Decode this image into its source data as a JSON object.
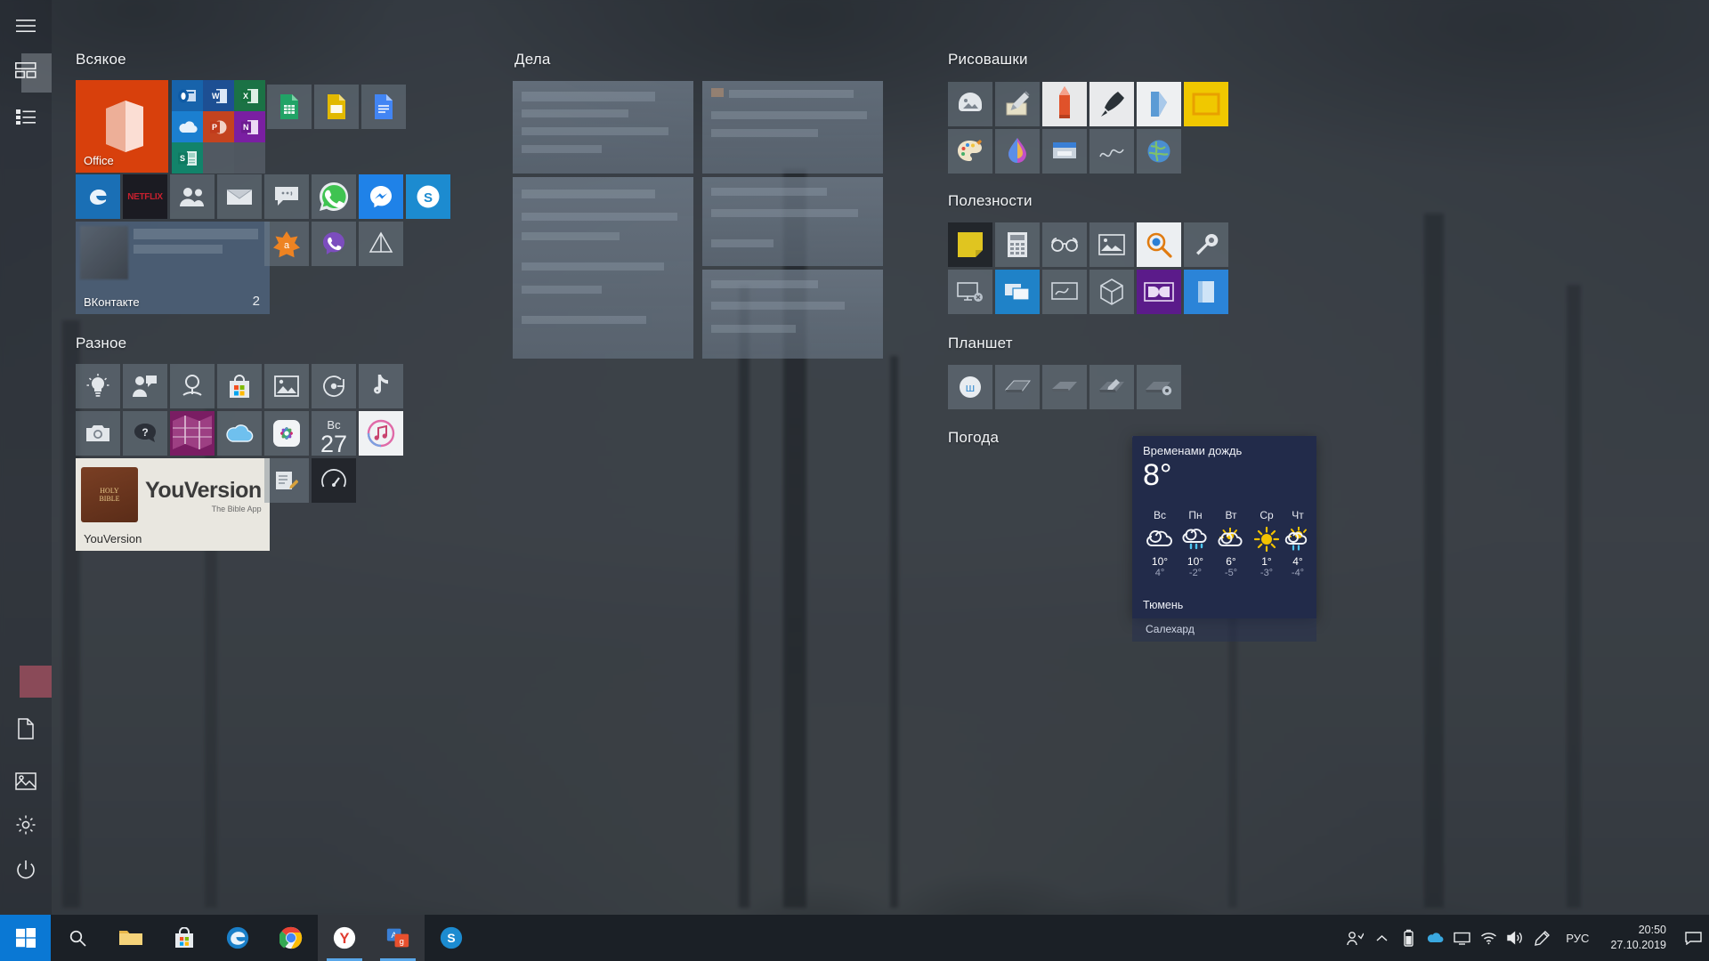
{
  "rail": {
    "items": [
      {
        "name": "hamburger",
        "label": "Развернуть"
      },
      {
        "name": "tiles-view",
        "label": "Плитки"
      },
      {
        "name": "all-apps",
        "label": "Все приложения"
      },
      {
        "name": "documents",
        "label": "Документы"
      },
      {
        "name": "pictures",
        "label": "Изображения"
      },
      {
        "name": "settings",
        "label": "Параметры"
      },
      {
        "name": "power",
        "label": "Выключение"
      }
    ]
  },
  "groups": {
    "vsyakoe": {
      "title": "Всякое"
    },
    "raznoe": {
      "title": "Разное"
    },
    "dela": {
      "title": "Дела"
    },
    "risovashki": {
      "title": "Рисовашки"
    },
    "poleznosti": {
      "title": "Полезности"
    },
    "planshet": {
      "title": "Планшет"
    },
    "pogoda": {
      "title": "Погода"
    }
  },
  "tiles": {
    "office": {
      "label": "Office"
    },
    "vk": {
      "label": "ВКонтакте",
      "badge": "2"
    },
    "netflix": {
      "label": "NETFLIX"
    },
    "calendar": {
      "day": "Вс",
      "date": "27"
    },
    "bible": {
      "label": "YouVersion",
      "book_line1": "HOLY",
      "book_line2": "BIBLE",
      "brand": "YouVersion",
      "tagline": "The Bible App"
    },
    "office_apps": {
      "outlook": "O",
      "word": "W",
      "excel": "X",
      "onedrive": "OneDrive",
      "powerpoint": "P",
      "onenote": "N",
      "sway": "S"
    },
    "google": {
      "sheets": "Sheets",
      "slides": "Slides",
      "docs": "Docs"
    }
  },
  "weather": {
    "condition": "Временами дождь",
    "temperature": "8°",
    "city": "Тюмень",
    "second_city": "Салехард",
    "forecast": [
      {
        "day": "Вс",
        "icon": "cloudy",
        "high": "10°",
        "low": "4°"
      },
      {
        "day": "Пн",
        "icon": "rain",
        "high": "10°",
        "low": "-2°"
      },
      {
        "day": "Вт",
        "icon": "partly-sunny",
        "high": "6°",
        "low": "-5°"
      },
      {
        "day": "Ср",
        "icon": "sunny",
        "high": "1°",
        "low": "-3°"
      },
      {
        "day": "Чт",
        "icon": "sun-rain",
        "high": "4°",
        "low": "-4°"
      }
    ]
  },
  "taskbar": {
    "start": "Пуск",
    "items": [
      {
        "name": "search",
        "label": "Поиск"
      },
      {
        "name": "file-explorer",
        "label": "Проводник"
      },
      {
        "name": "microsoft-store",
        "label": "Microsoft Store"
      },
      {
        "name": "edge",
        "label": "Microsoft Edge"
      },
      {
        "name": "chrome",
        "label": "Google Chrome"
      },
      {
        "name": "yandex-browser",
        "label": "Яндекс.Браузер"
      },
      {
        "name": "translate",
        "label": "Переводчик"
      },
      {
        "name": "skype",
        "label": "Skype"
      }
    ],
    "tray": {
      "language": "РУС",
      "time": "20:50",
      "date": "27.10.2019",
      "icons": [
        "people",
        "chevron-up",
        "battery",
        "onedrive",
        "screen",
        "wifi",
        "volume",
        "pen"
      ]
    }
  },
  "colors": {
    "office_orange": "#d8400c",
    "accent_blue": "#0a78d4",
    "weather_bg": "#222b4a",
    "taskbar_bg": "#1b2026"
  }
}
